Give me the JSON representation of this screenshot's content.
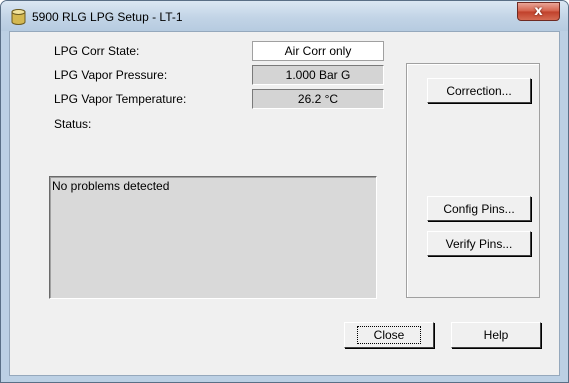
{
  "window": {
    "title": "5900 RLG LPG Setup - LT-1",
    "close_glyph": "x",
    "icon": "database-icon"
  },
  "fields": {
    "corr_state_label": "LPG Corr State:",
    "corr_state_value": "Air Corr only",
    "vapor_pressure_label": "LPG Vapor Pressure:",
    "vapor_pressure_value": "1.000 Bar G",
    "vapor_temperature_label": "LPG Vapor Temperature:",
    "vapor_temperature_value": "26.2 °C"
  },
  "status": {
    "label": "Status:",
    "text": "No problems detected"
  },
  "buttons": {
    "correction": "Correction...",
    "config_pins": "Config Pins...",
    "verify_pins": "Verify Pins...",
    "close": "Close",
    "help": "Help"
  }
}
